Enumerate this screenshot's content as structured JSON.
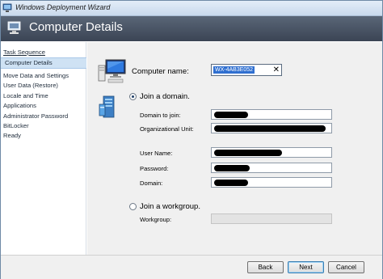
{
  "window": {
    "title": "Windows Deployment Wizard"
  },
  "banner": {
    "title": "Computer Details",
    "icon": "wizard-computer-icon"
  },
  "sidebar": {
    "items": [
      {
        "label": "Task Sequence",
        "state": "header"
      },
      {
        "label": "Computer Details",
        "state": "selected"
      },
      {
        "label": "Move Data and Settings",
        "state": "normal"
      },
      {
        "label": "User Data (Restore)",
        "state": "normal"
      },
      {
        "label": "Locale and Time",
        "state": "normal"
      },
      {
        "label": "Applications",
        "state": "normal"
      },
      {
        "label": "Administrator Password",
        "state": "normal"
      },
      {
        "label": "BitLocker",
        "state": "normal"
      },
      {
        "label": "Ready",
        "state": "normal"
      }
    ]
  },
  "form": {
    "computer_name_label": "Computer name:",
    "computer_name_value": "WX-4AB3E052",
    "join_domain_label": "Join a domain.",
    "join_domain_selected": true,
    "domain_to_join_label": "Domain to join:",
    "ou_label": "Organizational Unit:",
    "user_name_label": "User Name:",
    "password_label": "Password:",
    "domain_label": "Domain:",
    "join_workgroup_label": "Join a workgroup.",
    "join_workgroup_selected": false,
    "workgroup_label": "Workgroup:"
  },
  "buttons": {
    "back": "Back",
    "next": "Next",
    "cancel": "Cancel"
  },
  "colors": {
    "banner": "#4a5565",
    "selected_item": "#cfe2f4",
    "selection": "#2f6fd0"
  }
}
